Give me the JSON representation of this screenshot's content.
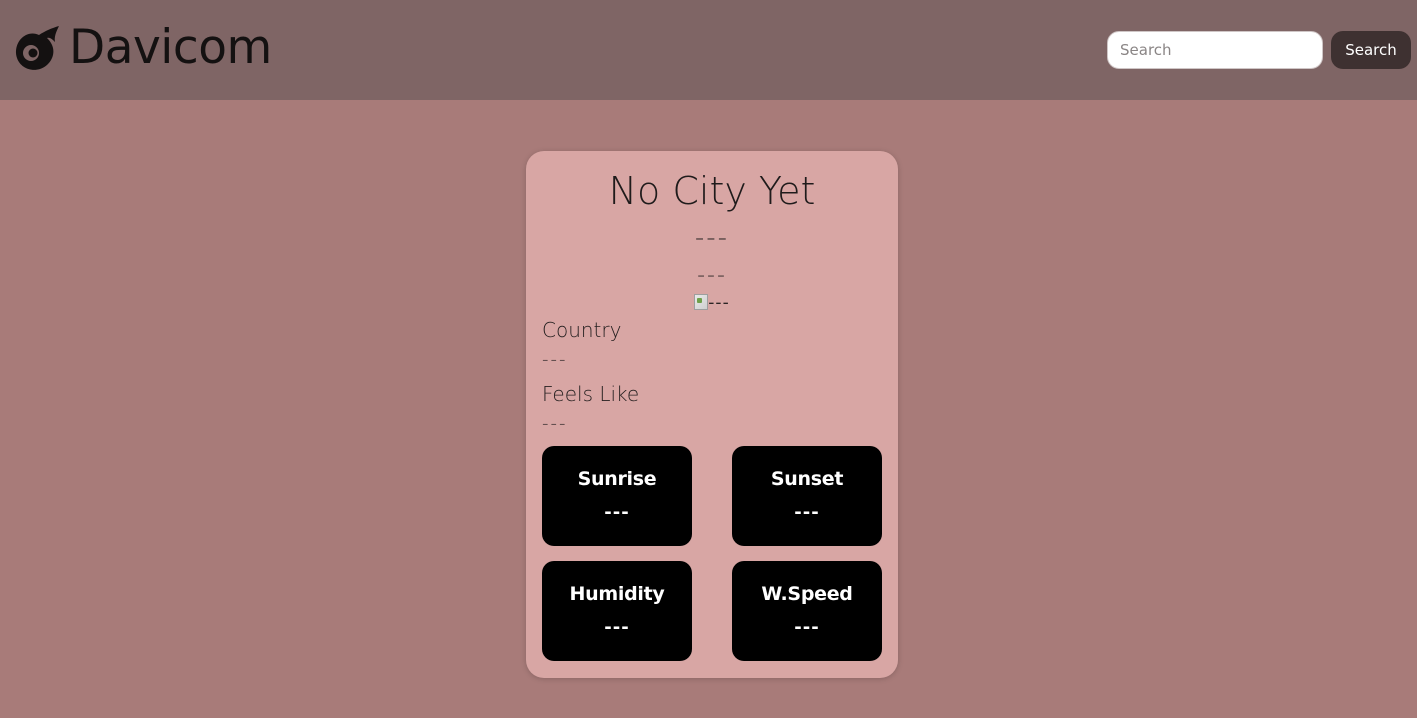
{
  "navbar": {
    "brand_name": "Davicom",
    "logo_icon": "comet-logo-icon",
    "search_placeholder": "Search",
    "search_value": "",
    "search_button_label": "Search"
  },
  "weather": {
    "city": "No City Yet",
    "temperature": "---",
    "description": "---",
    "icon_alt": "---",
    "country_label": "Country",
    "country_value": "---",
    "feels_like_label": "Feels Like",
    "feels_like_value": "---"
  },
  "stats": {
    "sunrise": {
      "label": "Sunrise",
      "value": "---"
    },
    "sunset": {
      "label": "Sunset",
      "value": "---"
    },
    "humidity": {
      "label": "Humidity",
      "value": "---"
    },
    "wind_speed": {
      "label": "W.Speed",
      "value": "---"
    }
  },
  "colors": {
    "page_background": "#a87b79",
    "navbar_background": "#7f6565",
    "card_background": "#d8a6a4",
    "tile_background": "#000000",
    "search_button_background": "#3e3131"
  }
}
